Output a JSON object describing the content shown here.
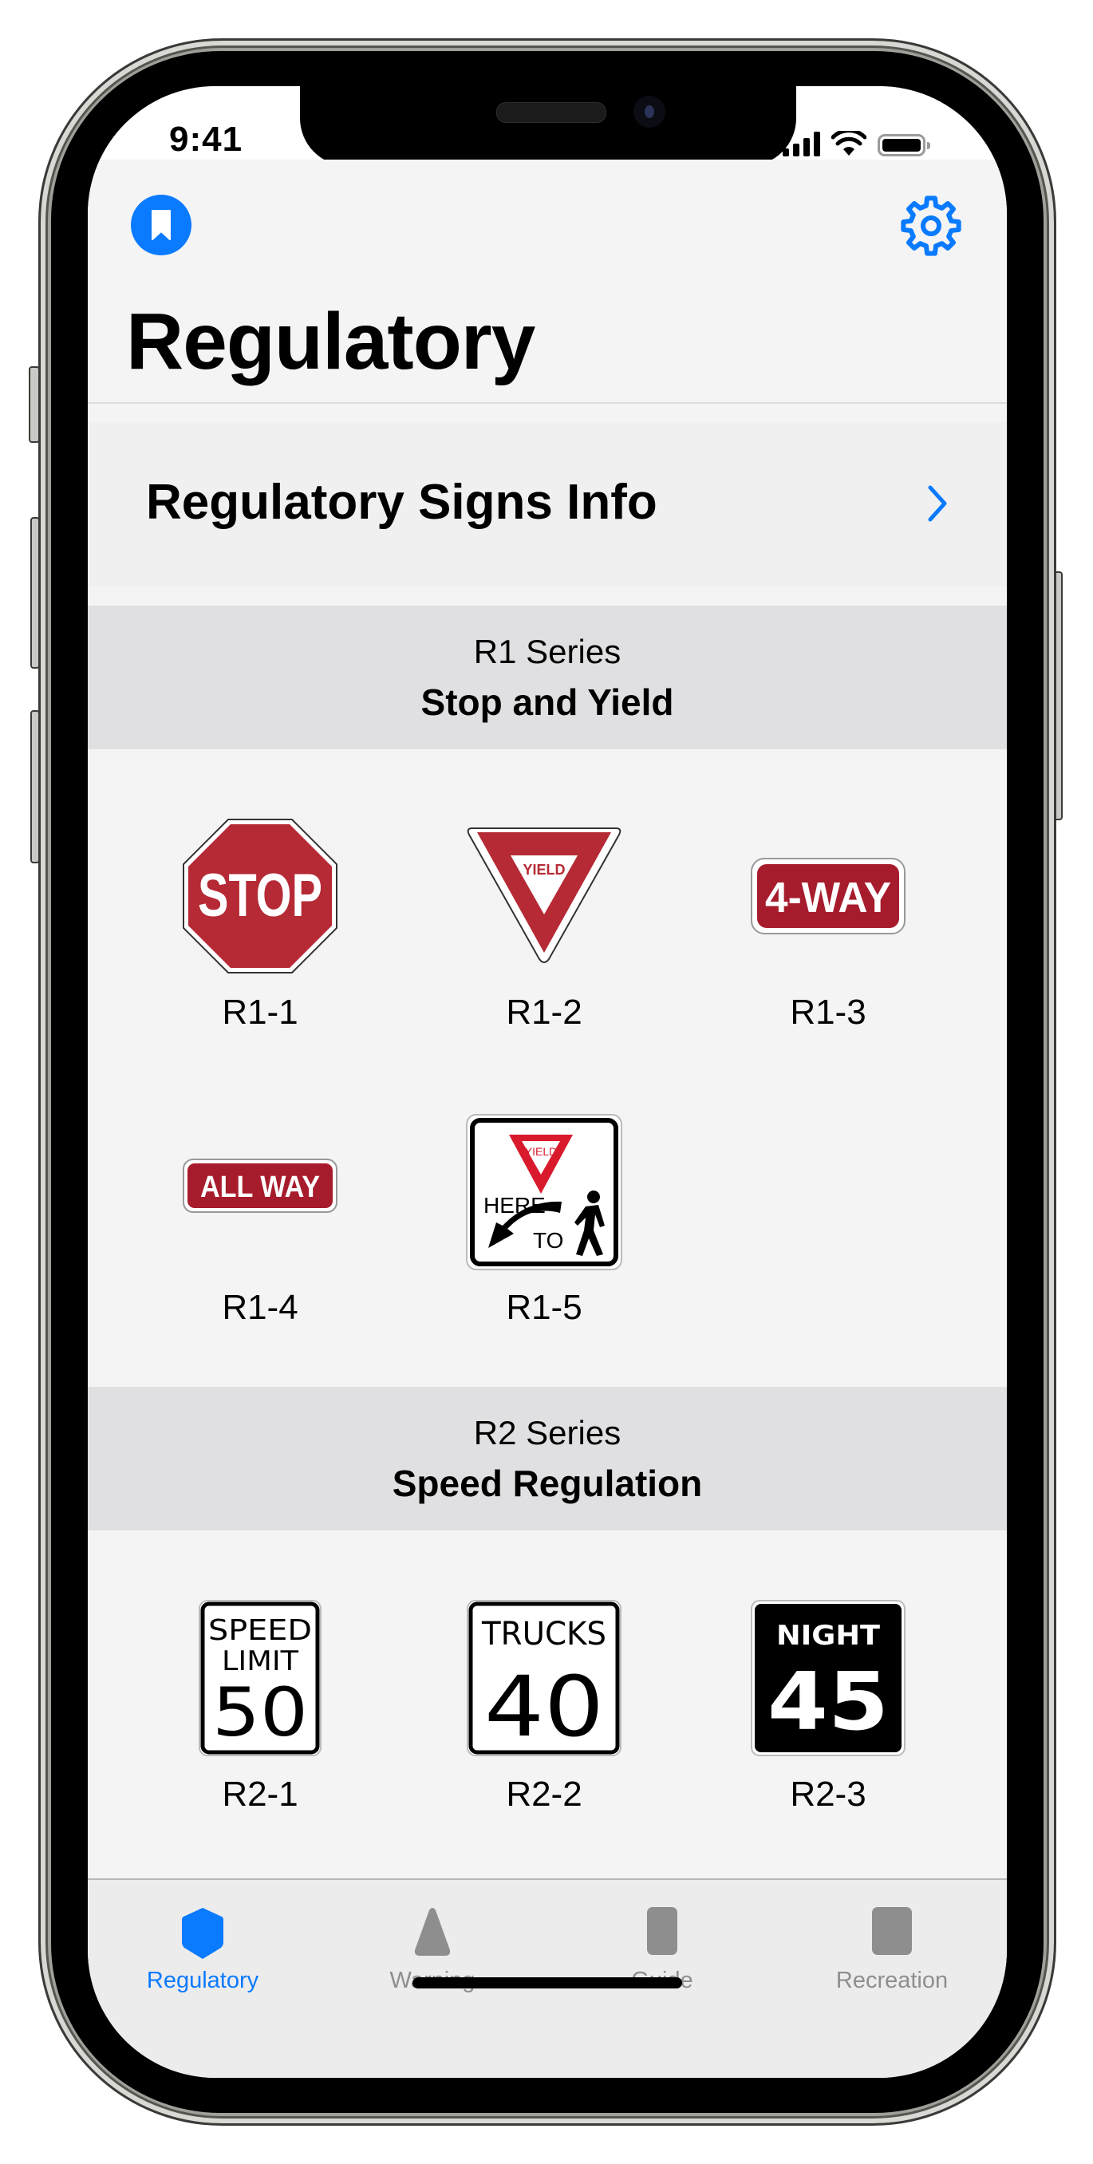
{
  "status_bar": {
    "time": "9:41",
    "icons": [
      "cellular-signal-icon",
      "wifi-icon",
      "battery-icon"
    ]
  },
  "nav": {
    "left_icon": "bookmark-icon",
    "right_icon": "gear-icon",
    "title": "Regulatory"
  },
  "info_row": {
    "label": "Regulatory Signs Info",
    "icon": "chevron-right-icon"
  },
  "sections": [
    {
      "series": "R1 Series",
      "title": "Stop and Yield",
      "signs": [
        {
          "code": "R1-1",
          "text": "STOP"
        },
        {
          "code": "R1-2",
          "text": "YIELD"
        },
        {
          "code": "R1-3",
          "text": "4-WAY"
        },
        {
          "code": "R1-4",
          "text": "ALL WAY"
        },
        {
          "code": "R1-5",
          "text": "YIELD HERE TO",
          "yield_text": "YIELD",
          "line1": "HERE",
          "line2": "TO"
        }
      ]
    },
    {
      "series": "R2 Series",
      "title": "Speed Regulation",
      "signs": [
        {
          "code": "R2-1",
          "line1": "SPEED",
          "line2": "LIMIT",
          "number": "50"
        },
        {
          "code": "R2-2",
          "line1": "TRUCKS",
          "number": "40"
        },
        {
          "code": "R2-3",
          "line1": "NIGHT",
          "number": "45"
        }
      ]
    }
  ],
  "tab_bar": {
    "selected": "Regulatory",
    "tabs": [
      {
        "label": "Regulatory",
        "icon": "shield-icon",
        "active": true
      },
      {
        "label": "Warning",
        "icon": "warning-triangle-icon",
        "active": false
      },
      {
        "label": "Guide",
        "icon": "guide-sign-icon",
        "active": false
      },
      {
        "label": "Recreation",
        "icon": "recreation-sign-icon",
        "active": false
      }
    ]
  },
  "colors": {
    "accent": "#0a7aff",
    "sign_red": "#b52a35",
    "inactive_tab": "#8e8e8e",
    "section_header_bg": "#e0e0e2",
    "background": "#f4f4f4"
  }
}
